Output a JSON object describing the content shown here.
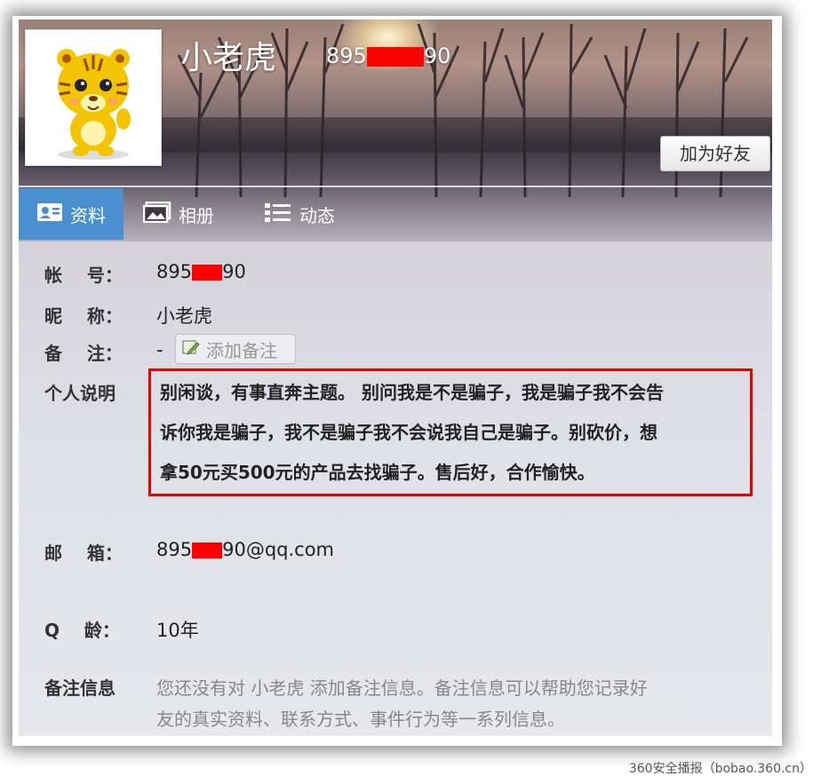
{
  "header": {
    "name": "小老虎",
    "qq_prefix": "895",
    "qq_suffix": "90",
    "add_friend_label": "加为好友"
  },
  "tabs": [
    {
      "label": "资料",
      "icon": "profile-card-icon",
      "active": true
    },
    {
      "label": "相册",
      "icon": "album-icon",
      "active": false
    },
    {
      "label": "动态",
      "icon": "feed-list-icon",
      "active": false
    }
  ],
  "info": {
    "account_label": "帐    号：",
    "account_prefix": "895",
    "account_suffix": "90",
    "nickname_label": "昵    称：",
    "nickname_value": "小老虎",
    "remark_label": "备    注：",
    "remark_value": "-",
    "add_remark_label": "添加备注",
    "bio_label": "个人说明",
    "bio_lines": [
      "别闲谈，有事直奔主题。 别问我是不是骗子，我是骗子我不会告",
      "诉你我是骗子，我不是骗子我不会说我自己是骗子。别砍价，想",
      "拿50元买500元的产品去找骗子。售后好，合作愉快。"
    ],
    "email_label": "邮    箱：",
    "email_prefix": "895",
    "email_suffix": "90@qq.com",
    "qage_label": "Q    龄：",
    "qage_value": "10年",
    "remark_info_label": "备注信息",
    "remark_info_lines": [
      "您还没有对 小老虎 添加备注信息。备注信息可以帮助您记录好",
      "友的真实资料、联系方式、事件行为等一系列信息。"
    ]
  },
  "footer": {
    "credit": "360安全播报（bobao.360.cn）"
  },
  "colors": {
    "accent_tab": "#4a8fd0",
    "highlight_border": "#ee0000",
    "redaction": "#ff0000"
  }
}
